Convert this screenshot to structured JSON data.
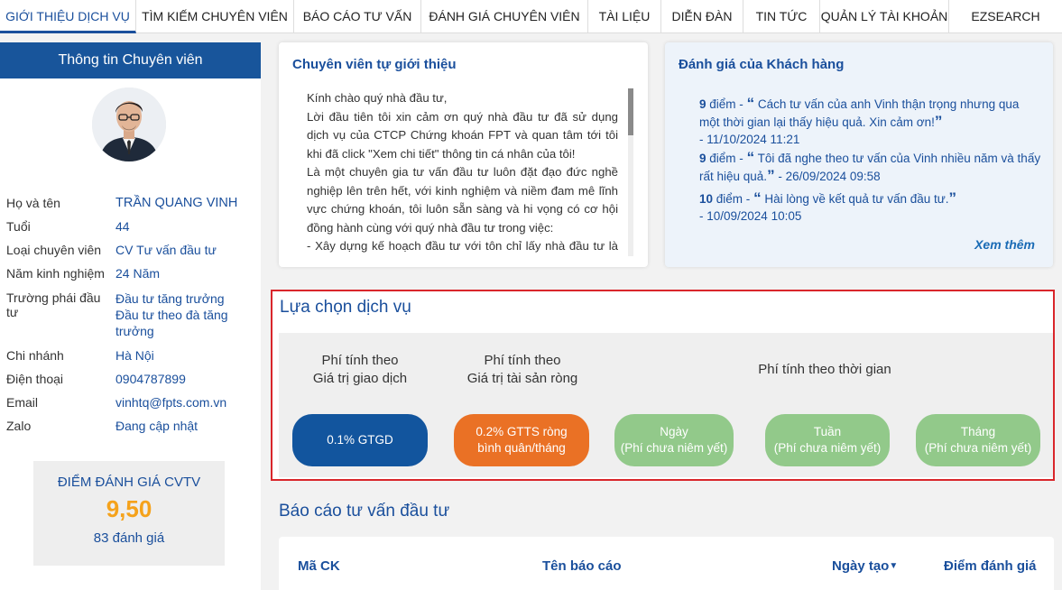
{
  "nav": {
    "items": [
      {
        "label": "GIỚI THIỆU DỊCH VỤ"
      },
      {
        "label": "TÌM KIẾM CHUYÊN VIÊN"
      },
      {
        "label": "BÁO CÁO TƯ VẤN"
      },
      {
        "label": "ĐÁNH GIÁ CHUYÊN VIÊN"
      },
      {
        "label": "TÀI LIỆU"
      },
      {
        "label": "DIỄN ĐÀN"
      },
      {
        "label": "TIN TỨC"
      },
      {
        "label": "QUẢN LÝ TÀI KHOẢN"
      },
      {
        "label": "EZSEARCH"
      }
    ]
  },
  "sidebar": {
    "heading": "Thông tin Chuyên viên",
    "fields": [
      {
        "label": "Họ và tên",
        "value": "TRẦN QUANG VINH"
      },
      {
        "label": "Tuổi",
        "value": "44"
      },
      {
        "label": "Loại chuyên viên",
        "value": "CV Tư vấn đầu tư"
      },
      {
        "label": "Năm kinh nghiệm",
        "value": "24 Năm"
      },
      {
        "label": "Trường phái đầu tư",
        "value": "Đầu tư tăng trưởng",
        "value2": "Đầu tư theo đà tăng trưởng"
      },
      {
        "label": "Chi nhánh",
        "value": "Hà Nội"
      },
      {
        "label": "Điện thoại",
        "value": "0904787899"
      },
      {
        "label": "Email",
        "value": "vinhtq@fpts.com.vn"
      },
      {
        "label": "Zalo",
        "value": "Đang cập nhật"
      }
    ],
    "score": {
      "title": "ĐIỂM ĐÁNH GIÁ CVTV",
      "value": "9,50",
      "count": "83 đánh giá"
    }
  },
  "intro": {
    "title": "Chuyên viên tự giới thiệu",
    "lines": [
      "Kính chào quý nhà đầu tư,",
      "Lời đầu tiên tôi xin cảm ơn quý nhà đầu tư đã sử dụng dịch vụ của CTCP Chứng khoán FPT và quan tâm tới tôi khi đã click \"Xem chi tiết\" thông tin cá nhân của tôi!",
      "Là một chuyên gia tư vấn đầu tư luôn đặt đạo đức nghề nghiệp lên trên hết, với kinh nghiệm và niềm đam mê lĩnh vực chứng khoán, tôi luôn sẵn sàng và hi vọng có cơ hội đồng hành cùng với quý nhà đầu tư trong việc:",
      "- Xây dựng kế hoạch đầu tư với tôn chỉ lấy nhà đầu tư là trung tâm;"
    ]
  },
  "reviews": {
    "title": "Đánh giá của Khách hàng",
    "items": [
      {
        "score": "9",
        "unit": "điểm -",
        "text": "Cách tư vấn của anh Vinh thận trọng nhưng qua một thời gian lại thấy hiệu quả. Xin cảm ơn!",
        "date": "- 11/10/2024 11:21"
      },
      {
        "score": "9",
        "unit": "điểm -",
        "text": "Tôi đã nghe theo tư vấn của Vinh nhiều năm và thấy rất hiệu quả.",
        "date": "- 26/09/2024 09:58"
      },
      {
        "score": "10",
        "unit": "điểm -",
        "text": "Hài lòng về kết quả tư vấn đầu tư.",
        "date": "- 10/09/2024 10:05"
      }
    ],
    "more": "Xem thêm"
  },
  "services": {
    "title": "Lựa chọn dịch vụ",
    "labels": [
      {
        "line1": "Phí tính theo",
        "line2": "Giá trị giao dịch"
      },
      {
        "line1": "Phí tính theo",
        "line2": "Giá trị tài sản ròng"
      },
      {
        "line1": "Phí tính theo thời gian",
        "line2": ""
      }
    ],
    "options": [
      {
        "line1": "0.1% GTGD",
        "line2": "",
        "color": "#12559e"
      },
      {
        "line1": "0.2% GTTS ròng",
        "line2": "bình quân/tháng",
        "color": "#ea7125"
      },
      {
        "line1": "Ngày",
        "line2": "(Phí chưa niêm yết)",
        "color": "#92c98a"
      },
      {
        "line1": "Tuần",
        "line2": "(Phí chưa niêm yết)",
        "color": "#92c98a"
      },
      {
        "line1": "Tháng",
        "line2": "(Phí chưa niêm yết)",
        "color": "#92c98a"
      }
    ]
  },
  "reports": {
    "title": "Báo cáo tư vấn đầu tư",
    "columns": [
      "Mã CK",
      "Tên báo cáo",
      "Ngày tạo",
      "Điểm đánh giá"
    ]
  },
  "colors": {
    "brand": "#18559b",
    "accent": "#f5a21b",
    "highlight": "#d9262b"
  }
}
